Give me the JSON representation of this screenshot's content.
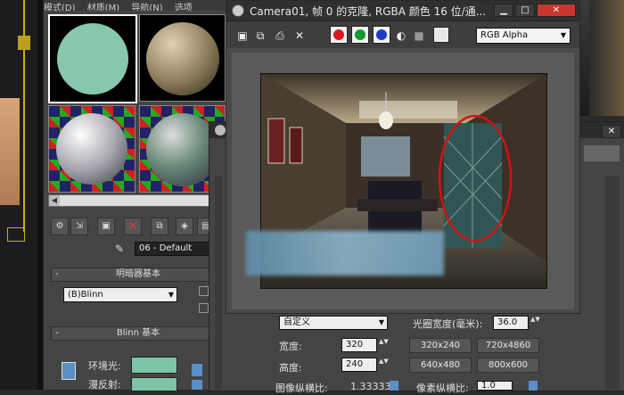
{
  "material_editor": {
    "menu": [
      "模式(D)",
      "材质(M)",
      "导航(N)",
      "选项"
    ],
    "material_name": "06 - Default",
    "shader_rollout": "明暗器基本",
    "shader_type": "(B)Blinn",
    "blinn_rollout": "Blinn 基本",
    "ambient_label": "环境光:",
    "diffuse_label": "漫反射:"
  },
  "frame_window": {
    "title": "Camera01, 帧 0 的克隆, RGBA 颜色 16 位/通...",
    "channel_select": "RGB Alpha"
  },
  "render_settings": {
    "preset": "自定义",
    "aperture_label": "光圈宽度(毫米):",
    "aperture_value": "36.0",
    "width_label": "宽度:",
    "width_value": "320",
    "height_label": "高度:",
    "height_value": "240",
    "presets": [
      "320x240",
      "720x4860",
      "640x480",
      "800x600"
    ],
    "image_aspect_label": "图像纵横比:",
    "image_aspect_value": "1.33333",
    "pixel_aspect_label": "像素纵横比:",
    "pixel_aspect_value": "1.0"
  },
  "colors": {
    "swatch": "#7bc4a7",
    "annotation_red": "#d01414"
  }
}
